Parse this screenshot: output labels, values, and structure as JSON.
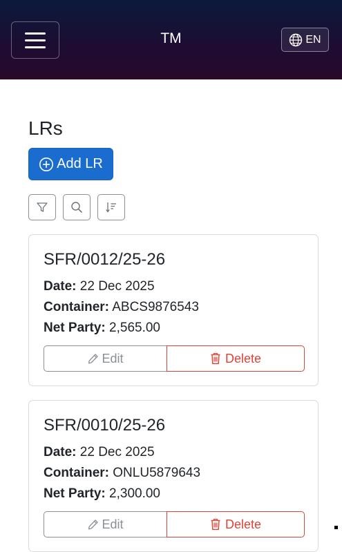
{
  "header": {
    "brand": "TM",
    "language_label": "EN"
  },
  "page": {
    "title": "LRs",
    "add_button_label": "Add LR"
  },
  "toolbar": {
    "icons": [
      "filter-icon",
      "search-icon",
      "sort-icon"
    ]
  },
  "labels": {
    "date": "Date:",
    "container": "Container:",
    "net_party": "Net Party:",
    "edit": "Edit",
    "delete": "Delete"
  },
  "records": [
    {
      "lr_number": "SFR/0012/25-26",
      "date": "22 Dec 2025",
      "container": "ABCS9876543",
      "net_party": "2,565.00"
    },
    {
      "lr_number": "SFR/0010/25-26",
      "date": "22 Dec 2025",
      "container": "ONLU5879643",
      "net_party": "2,300.00"
    }
  ],
  "colors": {
    "primary": "#1a6ccf",
    "danger": "#d9443a",
    "header_gradient_top": "#0b1a3c",
    "header_gradient_bottom": "#280929"
  }
}
